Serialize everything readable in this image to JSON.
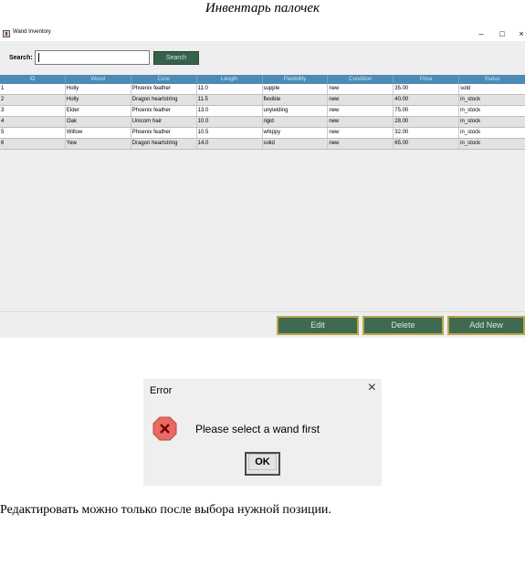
{
  "doc_title": "Инвентарь палочек",
  "window": {
    "title": "Wand Inventory",
    "controls": {
      "minimize": "–",
      "maximize": "□",
      "close": "×"
    }
  },
  "search": {
    "label": "Search:",
    "value": "",
    "button_label": "Search"
  },
  "table": {
    "columns": [
      "ID",
      "Wood",
      "Core",
      "Length",
      "Flexibility",
      "Condition",
      "Price",
      "Status"
    ],
    "rows": [
      [
        "1",
        "Holly",
        "Phoenix feather",
        "11.0",
        "supple",
        "new",
        "35.00",
        "sold"
      ],
      [
        "2",
        "Holly",
        "Dragon heartstring",
        "11.5",
        "flexible",
        "new",
        "40.00",
        "in_stock"
      ],
      [
        "3",
        "Elder",
        "Phoenix feather",
        "13.0",
        "unyielding",
        "new",
        "75.00",
        "in_stock"
      ],
      [
        "4",
        "Oak",
        "Unicorn hair",
        "10.0",
        "rigid",
        "new",
        "28.00",
        "in_stock"
      ],
      [
        "5",
        "Willow",
        "Phoenix feather",
        "10.5",
        "whippy",
        "new",
        "32.00",
        "in_stock"
      ],
      [
        "6",
        "Yew",
        "Dragon heartstring",
        "14.0",
        "solid",
        "new",
        "65.00",
        "in_stock"
      ]
    ]
  },
  "actions": {
    "edit": "Edit",
    "delete": "Delete",
    "add_new": "Add New"
  },
  "dialog": {
    "title": "Error",
    "close": "×",
    "message": "Please select a wand first",
    "ok": "OK",
    "icon": "error-icon"
  },
  "caption": "Редактировать можно только после выбора нужной позиции.",
  "colors": {
    "header_blue": "#4d8ab5",
    "button_green": "#3f6a50",
    "button_border_gold": "#b9a64a",
    "error_red": "#d9534f"
  }
}
